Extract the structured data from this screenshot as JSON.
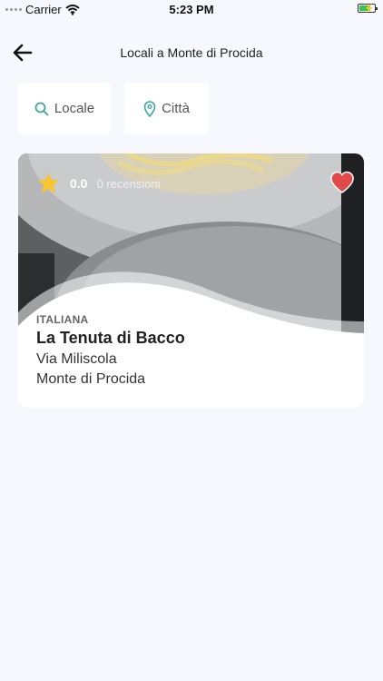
{
  "status_bar": {
    "carrier": "Carrier",
    "time": "5:23 PM",
    "battery_level": 0.75
  },
  "nav": {
    "title": "Locali a Monte di Procida"
  },
  "filters": [
    {
      "label": "Locale",
      "icon": "search-icon"
    },
    {
      "label": "Città",
      "icon": "location-pin-icon"
    }
  ],
  "restaurant": {
    "rating": "0.0",
    "reviews": "0 recensioni",
    "category": "ITALIANA",
    "name": "La Tenuta di Bacco",
    "address": "Via Miliscola",
    "city": "Monte di Procida",
    "favorite": true
  },
  "colors": {
    "accent": "#3aa89a",
    "heart": "#e24a4a",
    "star": "#f7c531",
    "background": "#f7f8fd",
    "battery": "#3ac24a"
  }
}
